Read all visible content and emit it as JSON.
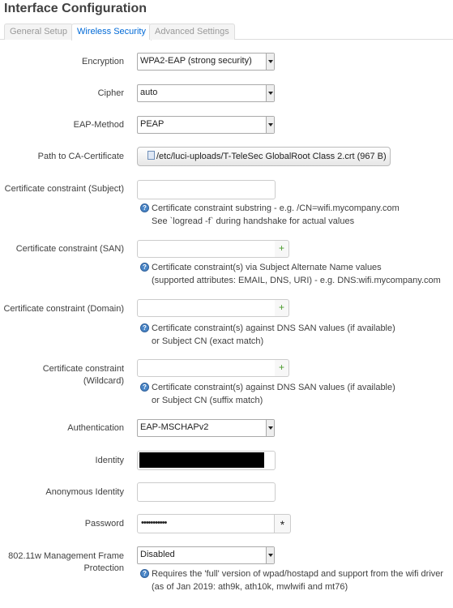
{
  "page_title": "Interface Configuration",
  "tabs": [
    {
      "label": "General Setup",
      "active": false
    },
    {
      "label": "Wireless Security",
      "active": true
    },
    {
      "label": "Advanced Settings",
      "active": false
    }
  ],
  "fields": {
    "encryption": {
      "label": "Encryption",
      "value": "WPA2-EAP (strong security)"
    },
    "cipher": {
      "label": "Cipher",
      "value": "auto"
    },
    "eap_method": {
      "label": "EAP-Method",
      "value": "PEAP"
    },
    "ca_cert": {
      "label": "Path to CA-Certificate",
      "value": "/etc/luci-uploads/T-TeleSec GlobalRoot Class 2.crt (967 B)"
    },
    "constraint_subject": {
      "label": "Certificate constraint (Subject)",
      "value": "",
      "help_line1": "Certificate constraint substring - e.g. /CN=wifi.mycompany.com",
      "help_line2": "See `logread -f` during handshake for actual values"
    },
    "constraint_san": {
      "label": "Certificate constraint (SAN)",
      "value": "",
      "add_label": "+",
      "help_line1": "Certificate constraint(s) via Subject Alternate Name values",
      "help_line2": "(supported attributes: EMAIL, DNS, URI) - e.g. DNS:wifi.mycompany.com"
    },
    "constraint_domain": {
      "label": "Certificate constraint (Domain)",
      "value": "",
      "add_label": "+",
      "help_line1": "Certificate constraint(s) against DNS SAN values (if available)",
      "help_line2": "or Subject CN (exact match)"
    },
    "constraint_wildcard": {
      "label_line1": "Certificate constraint",
      "label_line2": "(Wildcard)",
      "value": "",
      "add_label": "+",
      "help_line1": "Certificate constraint(s) against DNS SAN values (if available)",
      "help_line2": "or Subject CN (suffix match)"
    },
    "authentication": {
      "label": "Authentication",
      "value": "EAP-MSCHAPv2"
    },
    "identity": {
      "label": "Identity",
      "value": ""
    },
    "anonymous_identity": {
      "label": "Anonymous Identity",
      "value": ""
    },
    "password": {
      "label": "Password",
      "value": "•••••••••••",
      "reveal_label": "*"
    },
    "mgmt_frame": {
      "label_line1": "802.11w Management Frame",
      "label_line2": "Protection",
      "value": "Disabled",
      "help_line1": "Requires the 'full' version of wpad/hostapd and support from the wifi driver",
      "help_line2": "(as of Jan 2019: ath9k, ath10k, mwlwifi and mt76)"
    }
  },
  "help_icon_glyph": "?",
  "colors": {
    "active_tab": "#0069d6",
    "inactive_tab": "#999999",
    "help_icon": "#4a86c7",
    "add_glyph": "#4a9a2c"
  }
}
